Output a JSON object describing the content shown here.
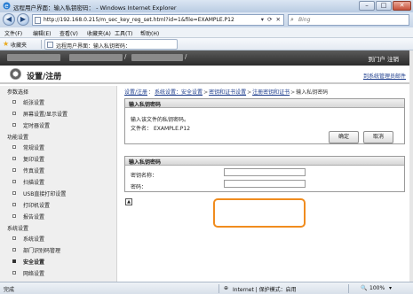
{
  "window": {
    "title": "远程用户界面：输入私钥密码：                    - Windows Internet Explorer",
    "minimize": "–",
    "maximize": "□",
    "close": "✕"
  },
  "address_bar": {
    "url": "http://192.168.0.215/m_sec_key_reg_set.html?id=1&file=EXAMPLE.P12",
    "tools": "▾ ⟳ ✕",
    "search_placeholder": "Bing",
    "back": "◀",
    "forward": "▶"
  },
  "menu": [
    "文件(F)",
    "编辑(E)",
    "查看(V)",
    "收藏夹(A)",
    "工具(T)",
    "帮助(H)"
  ],
  "favorites": {
    "label": "收藏夹",
    "tab_title": "远程用户界面：输入私钥密码："
  },
  "device_header": {
    "login_out": "到门户   注销"
  },
  "settings_header": {
    "title": "设置/注册",
    "admin_mode": "到系统管理员邮件"
  },
  "sidebar": {
    "categories": [
      {
        "label": "参数选择",
        "items": [
          {
            "label": "纸张设置",
            "active": false
          },
          {
            "label": "屏幕设置/显示设置",
            "active": false
          },
          {
            "label": "定时器设置",
            "active": false
          }
        ]
      },
      {
        "label": "功能设置",
        "items": [
          {
            "label": "常规设置",
            "active": false
          },
          {
            "label": "复印设置",
            "active": false
          },
          {
            "label": "传真设置",
            "active": false
          },
          {
            "label": "扫描设置",
            "active": false
          },
          {
            "label": "USB直接打印设置",
            "active": false
          },
          {
            "label": "打印机设置",
            "active": false
          },
          {
            "label": "报告设置",
            "active": false
          }
        ]
      },
      {
        "label": "系统设置",
        "items": [
          {
            "label": "系统设置",
            "active": false
          },
          {
            "label": "部门识别码管理",
            "active": false
          },
          {
            "label": "安全设置",
            "active": true
          },
          {
            "label": "网络设置",
            "active": false
          }
        ]
      }
    ]
  },
  "breadcrumb": [
    "设置/注册",
    "系统设置：安全设置",
    "密钥和证书设置",
    "注册密钥和证书",
    "输入私钥密码"
  ],
  "panel_input": {
    "header": "输入私钥密码",
    "description": "输入该文件的私钥密码。",
    "filename_label": "文件名：",
    "filename_value": "EXAMPLE.P12",
    "ok_label": "确定",
    "cancel_label": "取消"
  },
  "panel_form": {
    "header": "输入私钥密码",
    "key_name_label": "密钥名称：",
    "key_name_value": "",
    "password_label": "密码：",
    "password_value": ""
  },
  "status_bar": {
    "left": "完成",
    "zone": "Internet | 保护模式：启用",
    "zoom": "100%"
  },
  "colors": {
    "highlight": "#f08c1e",
    "header_dark": "#2c2c2c",
    "link": "#1c3c8c"
  }
}
